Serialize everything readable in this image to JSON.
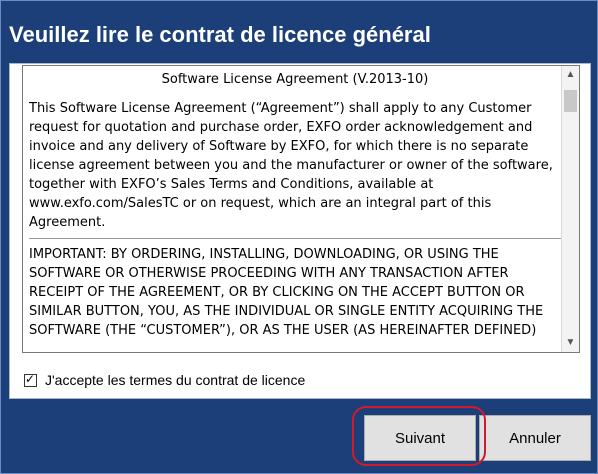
{
  "dialog": {
    "title": "Veuillez lire le contrat de licence général"
  },
  "license": {
    "heading": "Software License Agreement (V.2013-10)",
    "paragraph1": "This Software License Agreement (“Agreement”) shall apply to any Customer request for quotation and purchase order, EXFO order acknowledgement and invoice and any delivery of Software by EXFO, for which there is no separate license agreement between you and the manufacturer or owner of the software, together with EXFO’s Sales Terms and Conditions, available at www.exfo.com/SalesTC or on request, which are an integral part of this Agreement.",
    "paragraph2": "IMPORTANT: BY ORDERING, INSTALLING, DOWNLOADING, OR USING THE SOFTWARE OR OTHERWISE PROCEEDING WITH ANY TRANSACTION AFTER RECEIPT OF THE AGREEMENT, OR BY CLICKING ON THE ACCEPT BUTTON OR SIMILAR BUTTON,  YOU, AS THE INDIVIDUAL OR SINGLE ENTITY ACQUIRING THE SOFTWARE (THE “CUSTOMER”), OR AS THE USER (AS HEREINAFTER DEFINED)"
  },
  "accept": {
    "checked": true,
    "label": "J'accepte les termes du contrat de licence"
  },
  "buttons": {
    "next": "Suivant",
    "cancel": "Annuler"
  },
  "icons": {
    "scroll_up": "▲",
    "scroll_down": "▼"
  },
  "colors": {
    "frame": "#1d3f79",
    "highlight": "#d11a2a"
  }
}
